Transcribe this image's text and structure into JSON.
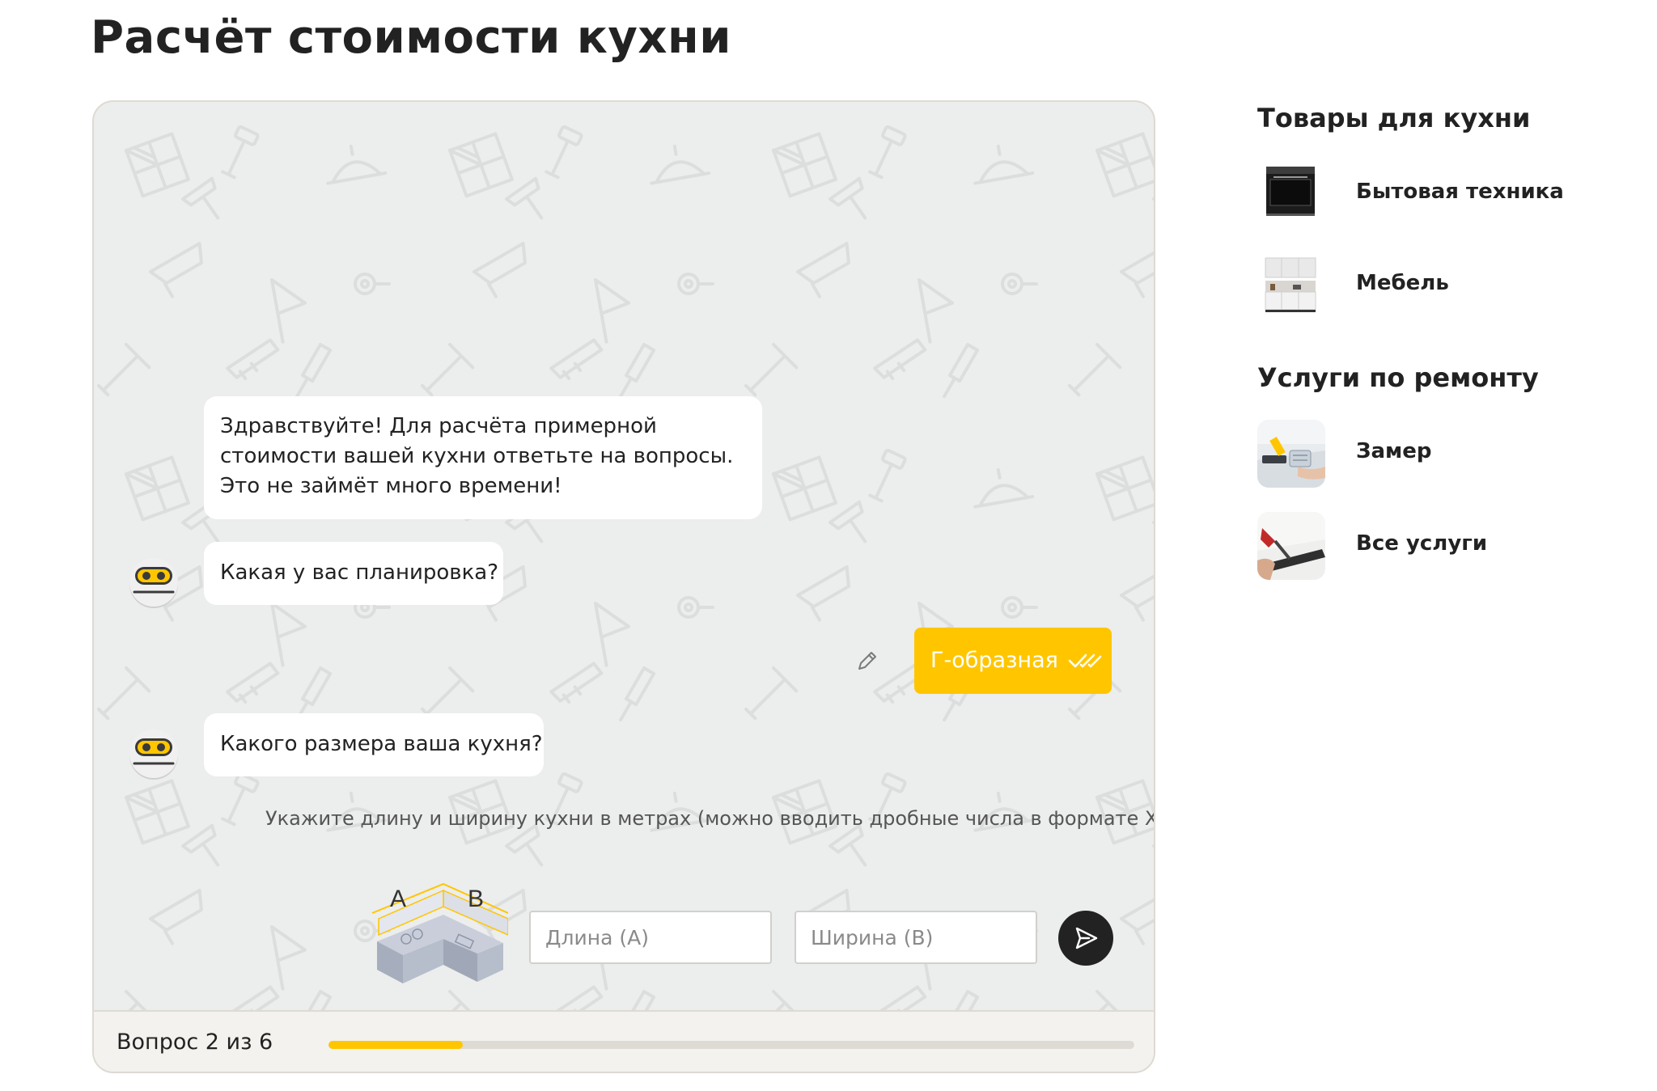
{
  "page": {
    "title": "Расчёт стоимости кухни"
  },
  "chat": {
    "messages": {
      "greeting": [
        "Здравствуйте! Для расчёта примерной",
        "стоимости вашей кухни ответьте на вопросы.",
        "Это не займёт много времени!"
      ],
      "q1": "Какая у вас планировка?",
      "answer1": "Г-образная",
      "q2": "Какого размера ваша кухня?"
    },
    "hint": "Укажите длину и ширину кухни в метрах (можно вводить дробные числа в формате Х,ХХ)",
    "illustration_labels": {
      "a": "A",
      "b": "B"
    },
    "inputs": {
      "length_placeholder": "Длина (А)",
      "length_value": "",
      "width_placeholder": "Ширина (В)",
      "width_value": ""
    },
    "send_icon": "send-arrow-icon",
    "edit_icon": "pencil-icon",
    "read_icon": "double-check-icon"
  },
  "progress": {
    "label": "Вопрос 2 из 6",
    "current": 2,
    "total": 6,
    "fill_fraction": 0.167
  },
  "sidebar": {
    "goods_heading": "Товары для кухни",
    "goods": [
      {
        "label": "Бытовая техника",
        "icon": "oven-thumbnail"
      },
      {
        "label": "Мебель",
        "icon": "kitchen-furniture-thumbnail"
      }
    ],
    "services_heading": "Услуги по ремонту",
    "services": [
      {
        "label": "Замер",
        "icon": "measurement-thumbnail"
      },
      {
        "label": "Все услуги",
        "icon": "tools-thumbnail"
      }
    ]
  },
  "colors": {
    "accent": "#ffc600",
    "text": "#222222",
    "chat_background": "#eceded",
    "footer_background": "#f4f2ee",
    "send_button": "#222222"
  }
}
